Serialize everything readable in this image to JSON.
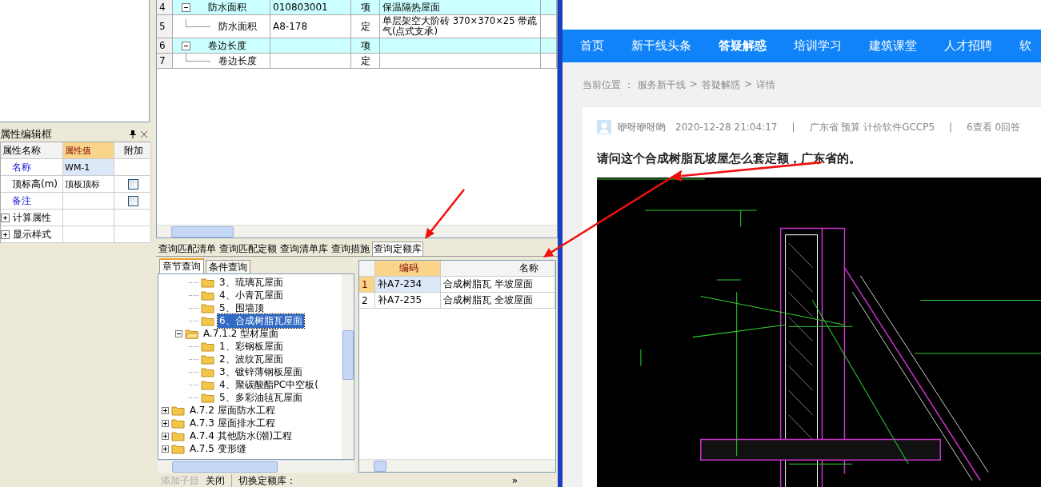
{
  "property_panel": {
    "title": "属性编辑框",
    "columns": [
      "属性名称",
      "属性值",
      "附加"
    ],
    "rows": [
      {
        "kind": "property",
        "name": "名称",
        "value": "WM-1",
        "public": true,
        "selected": true
      },
      {
        "kind": "property",
        "name": "顶标高(m)",
        "value": "顶板顶标",
        "public": false,
        "selected": false,
        "checked": false
      },
      {
        "kind": "property",
        "name": "备注",
        "public": true,
        "selected": false,
        "checked": false
      },
      {
        "kind": "group",
        "name": "计算属性",
        "expanded": false
      },
      {
        "kind": "group",
        "name": "显示样式",
        "expanded": false
      }
    ]
  },
  "quota_table": {
    "rows": [
      {
        "num": "4",
        "kind": "item",
        "expanded": true,
        "name": "防水面积",
        "code": "010803001",
        "type": "项",
        "description": "保温隔热屋面"
      },
      {
        "num": "5",
        "kind": "quota",
        "name": "防水面积",
        "code": "A8-178",
        "type": "定",
        "description": "单层架空大阶砖 370×370×25 带疏气(点式支承)"
      },
      {
        "num": "6",
        "kind": "item",
        "expanded": true,
        "name": "卷边长度",
        "type": "项"
      },
      {
        "num": "7",
        "kind": "quota",
        "name": "卷边长度",
        "type": "定"
      }
    ]
  },
  "query_panel": {
    "tabs": [
      {
        "label": "查询匹配清单",
        "selected": false
      },
      {
        "label": "查询匹配定额",
        "selected": false
      },
      {
        "label": "查询清单库",
        "selected": false
      },
      {
        "label": "查询措施",
        "selected": false
      },
      {
        "label": "查询定额库",
        "selected": true
      }
    ],
    "subtabs": [
      {
        "label": "章节查询",
        "selected": true
      },
      {
        "label": "条件查询",
        "selected": false
      }
    ],
    "tree": [
      {
        "children": [
          {
            "children": [
              {
                "label": "3、琉璃瓦屋面",
                "selected": false
              },
              {
                "label": "4、小青瓦屋面",
                "selected": false
              },
              {
                "label": "5、围墙顶",
                "selected": false
              },
              {
                "label": "6、合成树脂瓦屋面",
                "selected": true
              }
            ]
          },
          {
            "label": "A.7.1.2 型材屋面",
            "selected": false,
            "expanded": true,
            "children": [
              {
                "label": "1、彩钢板屋面",
                "selected": false
              },
              {
                "label": "2、波纹瓦屋面",
                "selected": false
              },
              {
                "label": "3、镀锌薄钢板屋面",
                "selected": false
              },
              {
                "label": "4、聚碳酸酯PC中空板(",
                "selected": false
              },
              {
                "label": "5、多彩油毡瓦屋面",
                "selected": false
              }
            ]
          }
        ]
      },
      {
        "label": "A.7.2 屋面防水工程",
        "selected": false,
        "expanded": false
      },
      {
        "label": "A.7.3 屋面排水工程",
        "selected": false,
        "expanded": false
      },
      {
        "label": "A.7.4 其他防水(潮)工程",
        "selected": false,
        "expanded": false
      },
      {
        "label": "A.7.5 变形缝",
        "selected": false,
        "expanded": false
      }
    ],
    "results": {
      "columns": [
        "编码",
        "名称"
      ],
      "rows": [
        {
          "num": "1",
          "code": "补A7-234",
          "name": "合成树脂瓦 半坡屋面",
          "selected": true
        },
        {
          "num": "2",
          "code": "补A7-235",
          "name": "合成树脂瓦 全坡屋面",
          "selected": false
        }
      ]
    },
    "status_bar": {
      "add_label": "添加子目",
      "add_disabled": true,
      "close_label": "关闭",
      "switch_label": "切换定额库：",
      "more": "»"
    }
  },
  "web": {
    "nav": [
      {
        "label": "首页",
        "selected": false
      },
      {
        "label": "新干线头条",
        "selected": false
      },
      {
        "label": "答疑解惑",
        "selected": true
      },
      {
        "label": "培训学习",
        "selected": false
      },
      {
        "label": "建筑课堂",
        "selected": false
      },
      {
        "label": "人才招聘",
        "selected": false
      },
      {
        "label": "软",
        "selected": false
      }
    ],
    "breadcrumb": [
      "当前位置 ：",
      "服务新干线",
      ">",
      "答疑解惑",
      ">",
      "详情"
    ],
    "meta": [
      {
        "kind": "author",
        "text": "咿呀咿呀哟"
      },
      {
        "kind": "text",
        "text": "2020-12-28 21:04:17"
      },
      {
        "kind": "sep",
        "text": "|"
      },
      {
        "kind": "text",
        "text": "广东省  预算 计价软件GCCP5"
      },
      {
        "kind": "sep",
        "text": "|"
      },
      {
        "kind": "text",
        "text": "6查看  0回答"
      }
    ],
    "question": "请问这个合成树脂瓦坡屋怎么套定额，广东省的。"
  }
}
